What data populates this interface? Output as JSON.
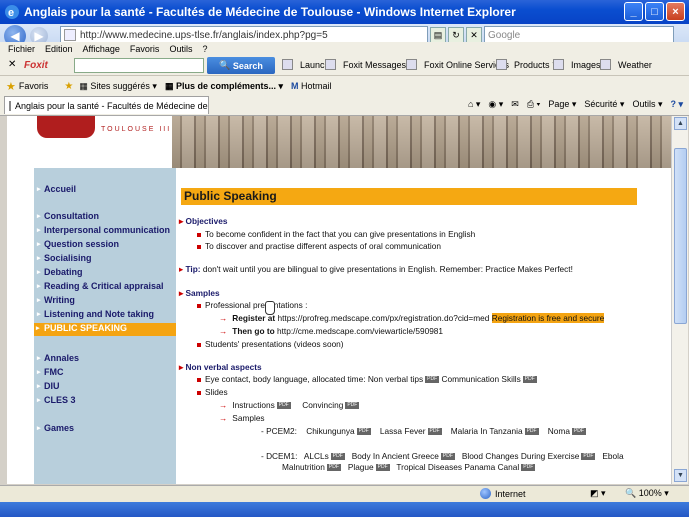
{
  "window": {
    "title": "Anglais pour la santé - Facultés de Médecine de Toulouse - Windows Internet Explorer",
    "min": "_",
    "max": "□",
    "close": "×"
  },
  "address": {
    "url": "http://www.medecine.ups-tlse.fr/anglais/index.php?pg=5",
    "search_placeholder": "Google"
  },
  "menu": [
    "Fichier",
    "Edition",
    "Affichage",
    "Favoris",
    "Outils",
    "?"
  ],
  "foxit": {
    "logo": "Foxit",
    "search_button": "Search",
    "items": [
      "Launch",
      "Foxit Messages",
      "Foxit Online Services",
      "Products",
      "Images",
      "Weather"
    ]
  },
  "favorites": {
    "favoris": "Favoris",
    "suggested": "Sites suggérés",
    "more": "Plus de compléments...",
    "hotmail": "Hotmail"
  },
  "tab": {
    "title": "Anglais pour la santé - Facultés de Médecine de Toulo...",
    "page": "Page",
    "security": "Sécurité",
    "tools": "Outils"
  },
  "banner": {
    "city": "TOULOUSE III"
  },
  "sidebar": {
    "items": [
      "Accueil",
      "Consultation",
      "Interpersonal communication",
      "Question session",
      "Socialising",
      "Debating",
      "Reading & Critical appraisal",
      "Writing",
      "Listening and Note taking",
      "PUBLIC SPEAKING",
      "Annales",
      "FMC",
      "DIU",
      "CLES 3",
      "Games"
    ]
  },
  "page": {
    "title": "Public Speaking",
    "objectives_heading": "Objectives",
    "objective1": "To become confident in the fact that you can give presentations in English",
    "objective2": "To discover and practise different aspects of oral communication",
    "tip_label": "Tip:",
    "tip_text": "don't wait until you are bilingual to give presentations in English. Remember: Practice Makes Perfect!",
    "samples_heading": "Samples",
    "prof_presentations": "Professional presentations :",
    "register_label": "Register at",
    "register_url": "https://profreg.medscape.com/px/registration.do?cid=med",
    "register_note": "Registration is free and secure",
    "thengo_label": "Then go to",
    "thengo_url": "http://cme.medscape.com/viewarticle/590981",
    "students": "Students' presentations (videos soon)",
    "nonverbal_heading": "Non verbal aspects",
    "nonverbal_line": "Eye contact, body language, allocated time: Non verbal tips",
    "comm_skills": "Communication Skills",
    "slides": "Slides",
    "instructions": "Instructions",
    "convincing": "Convincing",
    "samples": "Samples",
    "pcem2_label": "- PCEM2:",
    "pcem2_items": [
      "Chikungunya",
      "Lassa Fever",
      "Malaria In Tanzania",
      "Noma"
    ],
    "dcem1_label": "- DCEM1:",
    "dcem1_items": [
      "ALCLs",
      "Body In Ancient Greece",
      "Blood Changes During Exercise",
      "Ebola",
      "Malnutrition",
      "Plague",
      "Tropical Diseases Panama Canal"
    ],
    "pdf": "PDF"
  },
  "status": {
    "zone": "Internet",
    "zoom": "100%"
  }
}
